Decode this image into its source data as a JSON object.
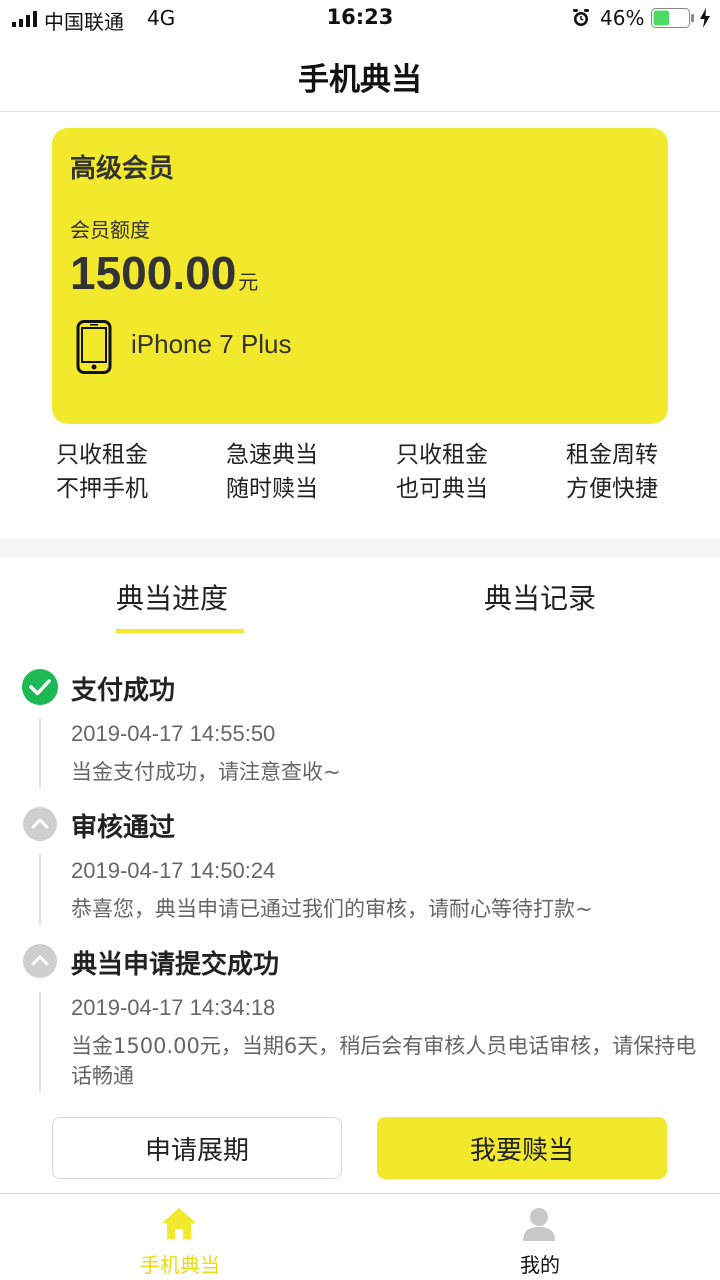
{
  "status_bar": {
    "carrier": "中国联通",
    "network": "4G",
    "time": "16:23",
    "battery": "46%",
    "battery_level": 0.46
  },
  "header": {
    "title": "手机典当"
  },
  "card": {
    "level": "高级会员",
    "quota_label": "会员额度",
    "amount": "1500.00",
    "unit": "元",
    "device": "iPhone 7 Plus"
  },
  "features": [
    {
      "line1": "只收租金",
      "line2": "不押手机"
    },
    {
      "line1": "急速典当",
      "line2": "随时赎当"
    },
    {
      "line1": "只收租金",
      "line2": "也可典当"
    },
    {
      "line1": "租金周转",
      "line2": "方便快捷"
    }
  ],
  "tabs": [
    {
      "label": "典当进度"
    },
    {
      "label": "典当记录"
    }
  ],
  "timeline": [
    {
      "title": "支付成功",
      "time": "2019-04-17 14:55:50",
      "desc": "当金支付成功，请注意查收~"
    },
    {
      "title": "审核通过",
      "time": "2019-04-17 14:50:24",
      "desc": "恭喜您，典当申请已通过我们的审核，请耐心等待打款~"
    },
    {
      "title": "典当申请提交成功",
      "time": "2019-04-17 14:34:18",
      "desc": "当金1500.00元，当期6天，稍后会有审核人员电话审核，请保持电话畅通"
    }
  ],
  "buttons": {
    "extend": "申请展期",
    "redeem": "我要赎当"
  },
  "tabbar": [
    {
      "label": "手机典当"
    },
    {
      "label": "我的"
    }
  ],
  "colors": {
    "accent": "#f2e82c",
    "success": "#1db954",
    "inactive": "#c8c8c8"
  }
}
